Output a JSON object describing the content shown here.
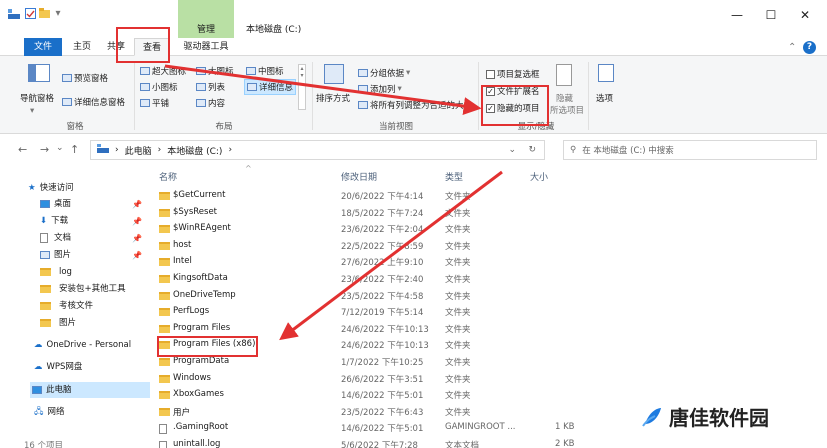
{
  "titlebar": {
    "context_tab": "管理",
    "title": "本地磁盘 (C:)",
    "minimize": "—",
    "maximize": "☐",
    "close": "✕"
  },
  "tabs": {
    "file": "文件",
    "home": "主页",
    "share": "共享",
    "view": "查看",
    "drive_tools": "驱动器工具",
    "help": "?"
  },
  "ribbon": {
    "nav_pane": "导航窗格",
    "preview_pane": "预览窗格",
    "details_pane": "详细信息窗格",
    "group_panes": "窗格",
    "xl_icons": "超大图标",
    "l_icons": "大图标",
    "m_icons": "中图标",
    "s_icons": "小图标",
    "list": "列表",
    "details": "详细信息",
    "tiles": "平铺",
    "content": "内容",
    "group_layout": "布局",
    "sort_by": "排序方式",
    "group_by": "分组依据",
    "add_columns": "添加列",
    "size_all_columns": "将所有列调整为合适的大小",
    "group_current_view": "当前视图",
    "item_checkboxes": "项目复选框",
    "file_extensions": "文件扩展名",
    "hidden_items": "隐藏的项目",
    "hide": "隐藏",
    "hide_selected": "所选项目",
    "group_show_hide": "显示/隐藏",
    "options": "选项"
  },
  "address": {
    "back": "←",
    "forward": "→",
    "up_chevron": "⌄",
    "up": "↑",
    "crumb_pc": "此电脑",
    "crumb_drive": "本地磁盘 (C:)",
    "sep": "›",
    "refresh": "↻",
    "search_placeholder": "在 本地磁盘 (C:) 中搜索"
  },
  "sidebar": {
    "quick_access": "快速访问",
    "desktop": "桌面",
    "downloads": "下载",
    "documents": "文档",
    "pictures": "图片",
    "log": "log",
    "install_pkg": "安装包+其他工具",
    "exam_files": "考核文件",
    "images": "图片",
    "onedrive": "OneDrive - Personal",
    "wps": "WPS网盘",
    "this_pc": "此电脑",
    "network": "网络",
    "item_count": "16 个项目"
  },
  "columns": {
    "name": "名称",
    "date": "修改日期",
    "type": "类型",
    "size": "大小"
  },
  "files": [
    {
      "name": "$GetCurrent",
      "date": "20/6/2022 下午4:14",
      "type": "文件夹",
      "size": ""
    },
    {
      "name": "$SysReset",
      "date": "18/5/2022 下午7:24",
      "type": "文件夹",
      "size": ""
    },
    {
      "name": "$WinREAgent",
      "date": "23/6/2022 下午2:04",
      "type": "文件夹",
      "size": ""
    },
    {
      "name": "host",
      "date": "22/5/2022 下午8:59",
      "type": "文件夹",
      "size": ""
    },
    {
      "name": "Intel",
      "date": "27/6/2022 上午9:10",
      "type": "文件夹",
      "size": ""
    },
    {
      "name": "KingsoftData",
      "date": "23/6/2022 下午2:40",
      "type": "文件夹",
      "size": ""
    },
    {
      "name": "OneDriveTemp",
      "date": "23/5/2022 下午4:58",
      "type": "文件夹",
      "size": ""
    },
    {
      "name": "PerfLogs",
      "date": "7/12/2019 下午5:14",
      "type": "文件夹",
      "size": ""
    },
    {
      "name": "Program Files",
      "date": "24/6/2022 下午10:13",
      "type": "文件夹",
      "size": ""
    },
    {
      "name": "Program Files (x86)",
      "date": "24/6/2022 下午10:13",
      "type": "文件夹",
      "size": ""
    },
    {
      "name": "ProgramData",
      "date": "1/7/2022 下午10:25",
      "type": "文件夹",
      "size": ""
    },
    {
      "name": "Windows",
      "date": "26/6/2022 下午3:51",
      "type": "文件夹",
      "size": ""
    },
    {
      "name": "XboxGames",
      "date": "14/6/2022 下午5:01",
      "type": "文件夹",
      "size": ""
    },
    {
      "name": "用户",
      "date": "23/5/2022 下午6:43",
      "type": "文件夹",
      "size": ""
    },
    {
      "name": ".GamingRoot",
      "date": "14/6/2022 下午5:01",
      "type": "GAMINGROOT ...",
      "size": "1 KB"
    },
    {
      "name": "unintall.log",
      "date": "5/6/2022 下午7:28",
      "type": "文本文档",
      "size": "2 KB"
    }
  ],
  "watermark": "唐佳软件园",
  "colors": {
    "accent": "#1a6fc9",
    "annotation": "#e23131",
    "folder": "#f3c74f"
  }
}
